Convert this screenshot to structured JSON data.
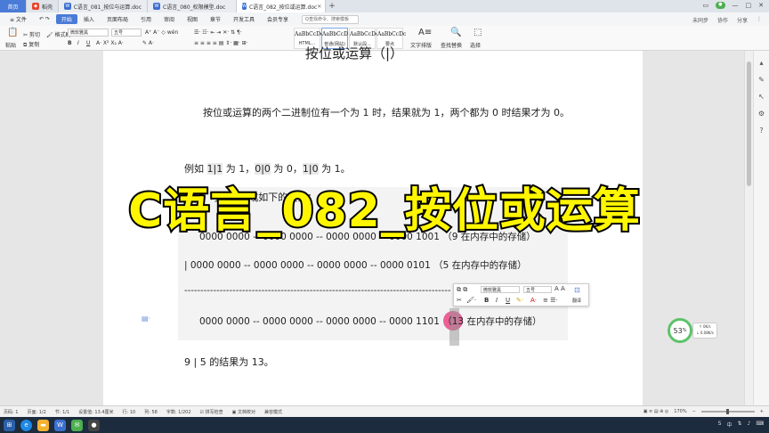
{
  "tabs": {
    "home": "首页",
    "daoke": "稻壳",
    "doc1": "C语言_081_按位与运算.doc",
    "doc2": "C语言_080_权限模型.doc",
    "doc3": "C语言_082_按位或运算.doc",
    "plus": "+"
  },
  "menus": {
    "file": "≡ 文件",
    "start": "开始",
    "insert": "插入",
    "page_layout": "页面布局",
    "reference": "引用",
    "review": "审阅",
    "view": "视图",
    "chapter": "章节",
    "devtools": "开发工具",
    "vip": "会员专享",
    "search_placeholder": "Q查找命令、搜索模板",
    "unsynced": "未同步",
    "collab": "协作",
    "share": "分享"
  },
  "ribbon": {
    "paste": "粘贴",
    "cut": "剪切",
    "copy": "复制",
    "format_painter": "格式刷",
    "font_name": "微软雅黑",
    "font_size": "五号",
    "styles": [
      {
        "sample": "AaBbCcDd",
        "name": "HTML..."
      },
      {
        "sample": "AaBbCcD",
        "name": "普通(网站)"
      },
      {
        "sample": "AaBbCcDd",
        "name": "默认段..."
      },
      {
        "sample": "AaBbCcDc",
        "name": "要点"
      }
    ],
    "text_layout": "文字排版",
    "find_replace": "查找替换",
    "select": "选择"
  },
  "document": {
    "heading_partial": "按位或运算（|）",
    "intro": "按位或运算的两个二进制位有一个为 1 时，结果就为 1，两个都为 0 时结果才为 0。",
    "example_prefix": "例如 ",
    "example_1": "1|1",
    "example_2": " 为 1，",
    "example_3": "0|0",
    "example_4": " 为 0，",
    "example_5": "1|0",
    "example_6": " 为 1。",
    "calc_label": "9 | 5 可以转换成如下的运算：",
    "line1": "0000 0000 -- 0000 0000 -- 0000 0000 -- 0000 1001 （9 在内存中的存储）",
    "line2": "|    0000 0000 -- 0000 0000 -- 0000 0000 -- 0000 0101 （5 在内存中的存储）",
    "dashes": "-----------------------------------------------------------------------------------",
    "line3_main": "0000 0000 -- 0000 0000 -- 0000 0000 -- 0000 1101 （",
    "line3_num": "13",
    "line3_end": " 在内存中的存储）",
    "result": "9 | 5 的结果为 13。"
  },
  "banner": {
    "title": "C语言_082_按位或运算"
  },
  "float_toolbar": {
    "font_name": "微软雅黑",
    "font_size": "五号",
    "translate": "翻译"
  },
  "gauge": {
    "value": "53",
    "unit": "%",
    "up": "0K/s",
    "down": "0.08K/s"
  },
  "status": {
    "page_num": "页码: 1",
    "page": "页面: 1/2",
    "section": "节: 1/1",
    "position": "设置值: 13.4厘米",
    "row": "行: 10",
    "col": "列: 58",
    "words": "字数: 1/202",
    "spell": "拼写检查",
    "proof": "文档校对",
    "compat": "兼容模式",
    "zoom": "170%"
  },
  "colors": {
    "accent": "#4a7bd6",
    "banner_text": "#fff600",
    "gauge": "#5cc36a",
    "marker": "#e84682"
  }
}
